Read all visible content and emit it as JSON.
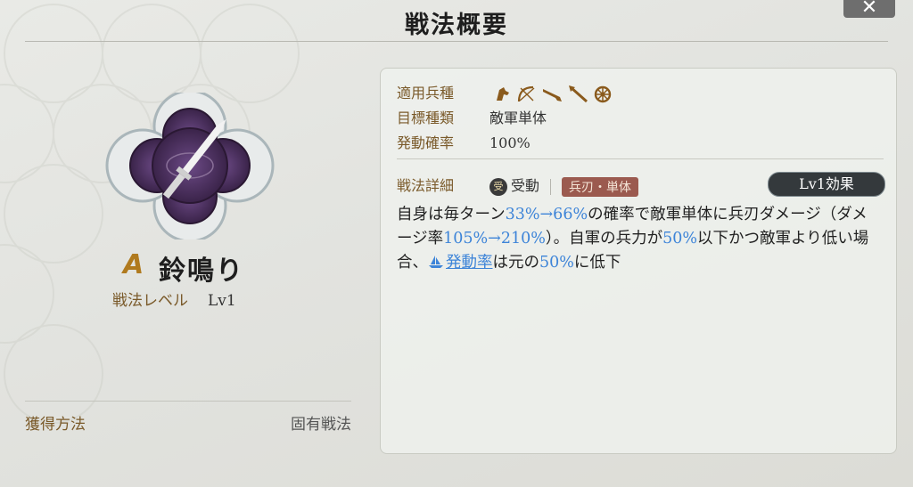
{
  "header": {
    "title": "戦法概要",
    "close_label": "✕"
  },
  "skill": {
    "grade": "A",
    "name": "鈴鳴り",
    "level_label": "戦法レベル",
    "level_value": "Lv1",
    "emblem_icon": "dagger-icon"
  },
  "acquisition": {
    "label": "獲得方法",
    "value": "固有戦法"
  },
  "info": {
    "troop_label": "適用兵種",
    "troop_icons": [
      "cavalry-icon",
      "bow-icon",
      "gun-icon",
      "spear-icon",
      "wheel-icon"
    ],
    "target_label": "目標種類",
    "target_value": "敵軍単体",
    "rate_label": "発動確率",
    "rate_value": "100%",
    "detail_label": "戦法詳細",
    "passive_symbol": "受",
    "passive_label": "受動",
    "tag": "兵刃・単体",
    "level_button": "Lv1効果"
  },
  "description": {
    "p1": "自身は毎ターン",
    "h1": "33%→66%",
    "p2": "の確率で敵軍単体に兵刃ダメージ（ダメージ率",
    "h2": "105%→210%",
    "p3": "）。自軍の兵力が",
    "h3": "50%",
    "p4": "以下かつ敵軍より低い場合、",
    "link": "発動率",
    "p5": "は元の",
    "h4": "50%",
    "p6": "に低下"
  },
  "colors": {
    "accent_blue": "#3d84d8",
    "label_brown": "#7a5a2a",
    "tag_bg": "#9b5a4f",
    "grade_gold": "#b07a1e"
  }
}
